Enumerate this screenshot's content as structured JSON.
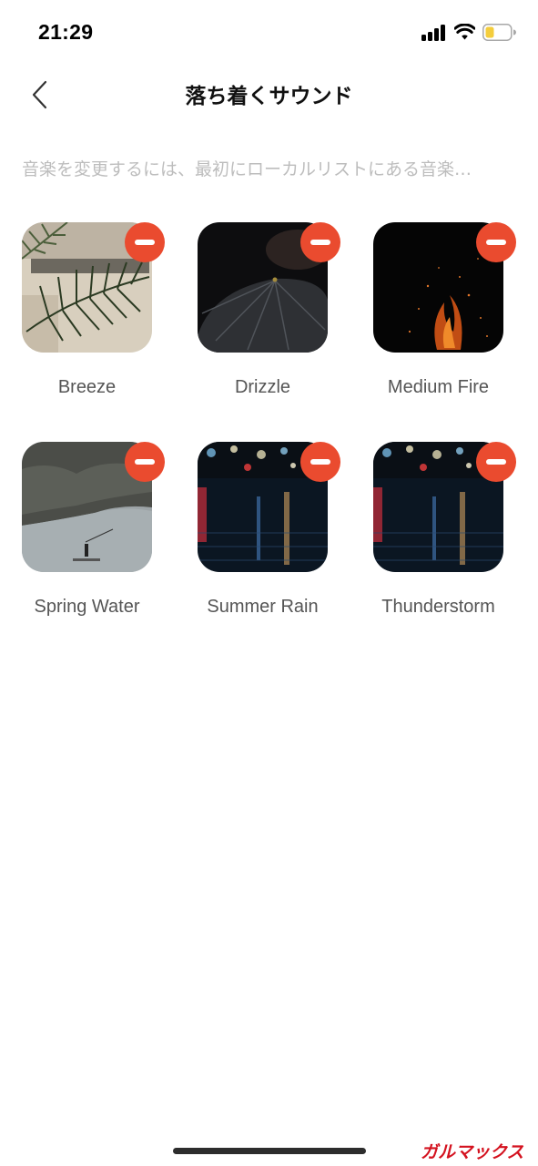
{
  "status_bar": {
    "time": "21:29",
    "battery_color": "#f4cd3c"
  },
  "header": {
    "title": "落ち着くサウンド",
    "back_icon": "chevron-left-icon"
  },
  "hint": "音楽を変更するには、最初にローカルリストにある音楽…",
  "sounds": [
    {
      "label": "Breeze",
      "thumbnail": "palm-leaf-shadow",
      "remove_icon": "minus-circle-icon"
    },
    {
      "label": "Drizzle",
      "thumbnail": "black-umbrella",
      "remove_icon": "minus-circle-icon"
    },
    {
      "label": "Medium Fire",
      "thumbnail": "fire-embers",
      "remove_icon": "minus-circle-icon"
    },
    {
      "label": "Spring Water",
      "thumbnail": "river-fisherman",
      "remove_icon": "minus-circle-icon"
    },
    {
      "label": "Summer Rain",
      "thumbnail": "rainy-night-street",
      "remove_icon": "minus-circle-icon"
    },
    {
      "label": "Thunderstorm",
      "thumbnail": "rainy-night-street",
      "remove_icon": "minus-circle-icon"
    }
  ],
  "colors": {
    "remove_button": "#ea4b2f",
    "hint_text": "#bdbdbd",
    "label_text": "#555555"
  },
  "watermark": "ガルマックス"
}
